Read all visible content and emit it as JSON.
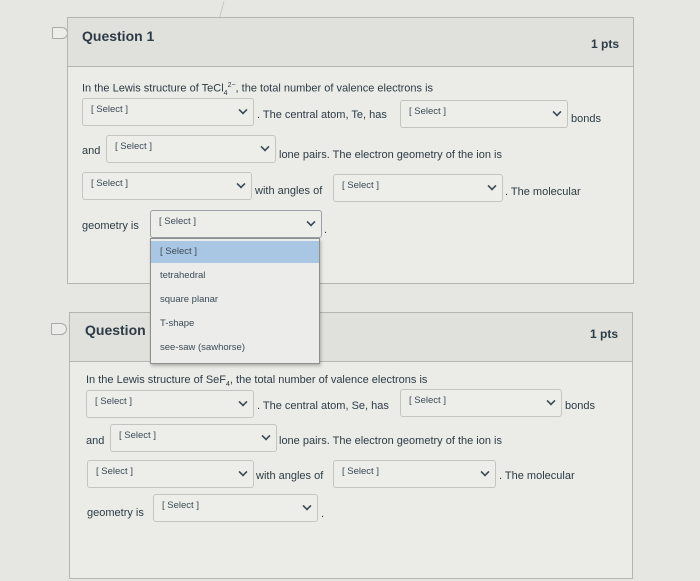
{
  "questions": [
    {
      "title": "Question 1",
      "points": "1 pts",
      "formula_prefix": "In the Lewis structure of TeCl",
      "formula_sub": "4",
      "formula_sup": "2−",
      "intro_suffix": ", the total number of valence electrons is",
      "central_atom_text": ". The central atom, Te, has",
      "bonds_text": "bonds",
      "and_text": "and",
      "lone_pairs_text": "lone pairs.  The electron geometry of the ion is",
      "angles_text": "with angles of",
      "molecular_text": ". The molecular",
      "geometry_text": "geometry is",
      "period_text": ".",
      "selects": {
        "valence_electrons": "[ Select ]",
        "bonds": "[ Select ]",
        "lone_pairs": "[ Select ]",
        "electron_geometry": "[ Select ]",
        "angles": "[ Select ]",
        "molecular_geometry": "[ Select ]"
      }
    },
    {
      "title": "Question",
      "points": "1 pts",
      "formula_prefix": "In the Lewis structure of SeF",
      "formula_sub": "4",
      "formula_sup": "",
      "intro_suffix": ", the total number of valence electrons is",
      "central_atom_text": ". The central atom, Se, has",
      "bonds_text": "bonds",
      "and_text": "and",
      "lone_pairs_text": "lone pairs.  The electron geometry of the ion is",
      "angles_text": "with angles of",
      "molecular_text": ". The molecular",
      "geometry_text": "geometry is",
      "period_text": ".",
      "selects": {
        "valence_electrons": "[ Select ]",
        "bonds": "[ Select ]",
        "lone_pairs": "[ Select ]",
        "electron_geometry": "[ Select ]",
        "angles": "[ Select ]",
        "molecular_geometry": "[ Select ]"
      }
    }
  ],
  "open_dropdown": {
    "options": [
      "[ Select ]",
      "tetrahedral",
      "square planar",
      "T-shape",
      "see-saw (sawhorse)"
    ],
    "highlighted_index": 0
  },
  "icons": {
    "flag": "bookmark-flag-icon",
    "chevron": "chevron-down-icon"
  },
  "colors": {
    "highlight": "#a9c7e3",
    "background": "#e6e6e2",
    "text": "#2d3b45"
  }
}
